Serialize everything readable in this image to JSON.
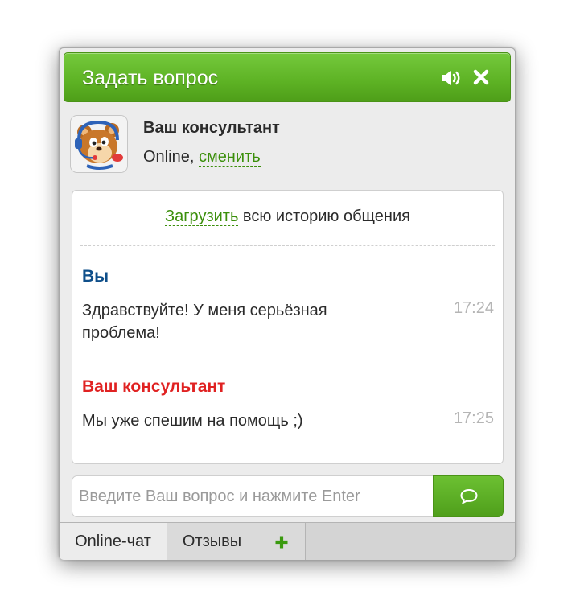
{
  "header": {
    "title": "Задать вопрос",
    "sound_icon": "speaker-icon",
    "close_icon": "close-icon"
  },
  "consultant": {
    "name": "Ваш консультант",
    "status": "Online",
    "status_separator": ", ",
    "change_link": "сменить",
    "avatar": "chipmunk-mascot-with-headset"
  },
  "chat": {
    "history_link": "Загрузить",
    "history_text": " всю историю общения",
    "messages": [
      {
        "author": "Вы",
        "author_color": "#0f4f8a",
        "text": "Здравствуйте! У меня серьёзная проблема!",
        "time": "17:24"
      },
      {
        "author": "Ваш консультант",
        "author_color": "#e02222",
        "text": "Мы уже спешим на помощь ;)",
        "time": "17:25"
      }
    ]
  },
  "input": {
    "placeholder": "Введите Ваш вопрос и нажмите Enter",
    "value": "",
    "send_icon": "speech-bubble-icon"
  },
  "tabs": [
    {
      "label": "Online-чат",
      "active": true
    },
    {
      "label": "Отзывы",
      "active": false
    },
    {
      "label": "+",
      "icon": "plus-icon",
      "active": false
    }
  ],
  "colors": {
    "accent_green": "#5db224",
    "link_green": "#3b8f0b",
    "user_author": "#0f4f8a",
    "consultant_author": "#e02222"
  }
}
